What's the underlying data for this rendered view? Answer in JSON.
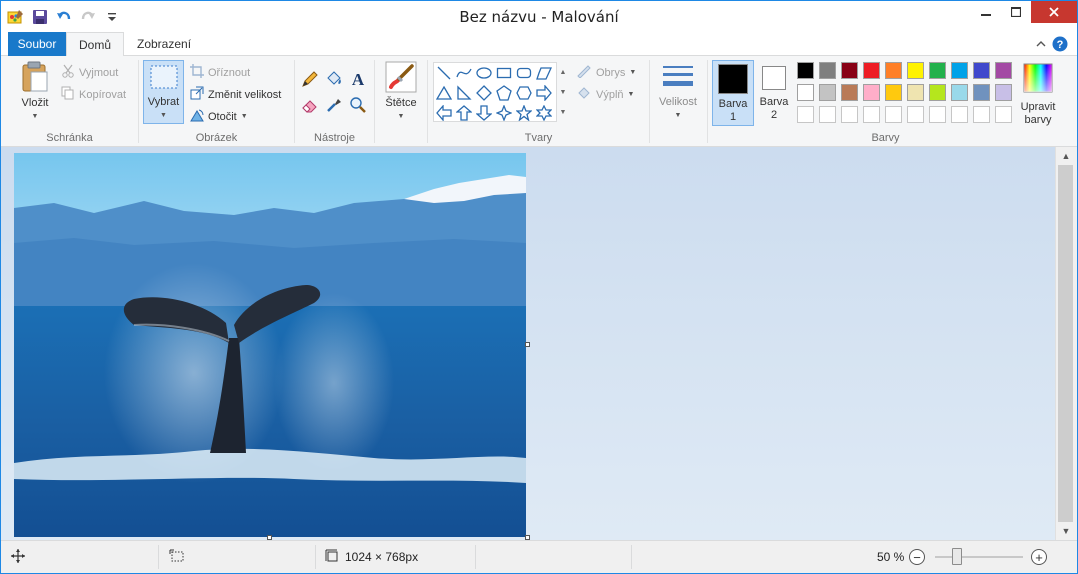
{
  "window": {
    "title": "Bez názvu - Malování",
    "controls": {
      "minimize": "—",
      "maximize": "☐",
      "close": "✕"
    }
  },
  "qat": {
    "icons": [
      "paint-app-icon",
      "save-icon",
      "undo-icon",
      "redo-icon",
      "customize-qat-icon"
    ]
  },
  "tabs": {
    "file": "Soubor",
    "home": "Domů",
    "view": "Zobrazení"
  },
  "ribbon": {
    "clipboard": {
      "label": "Schránka",
      "paste": "Vložit",
      "cut": "Vyjmout",
      "copy": "Kopírovat"
    },
    "image": {
      "label": "Obrázek",
      "select": "Vybrat",
      "crop": "Oříznout",
      "resize": "Změnit velikost",
      "rotate": "Otočit"
    },
    "tools": {
      "label": "Nástroje"
    },
    "brushes": {
      "label": "Štětce"
    },
    "shapes": {
      "label": "Tvary",
      "outline": "Obrys",
      "fill": "Výplň"
    },
    "size": {
      "label": "Velikost"
    },
    "colors": {
      "label": "Barvy",
      "color1_a": "Barva",
      "color1_b": "1",
      "color2_a": "Barva",
      "color2_b": "2",
      "edit_a": "Upravit",
      "edit_b": "barvy",
      "color1_value": "#000000",
      "color2_value": "#ffffff",
      "palette_row1": [
        "#000000",
        "#7f7f7f",
        "#880015",
        "#ed1c24",
        "#ff7f27",
        "#fff200",
        "#22b14c",
        "#00a2e8",
        "#3f48cc",
        "#a349a4"
      ],
      "palette_row2": [
        "#ffffff",
        "#c3c3c3",
        "#b97a57",
        "#ffaec9",
        "#ffc90e",
        "#efe4b0",
        "#b5e61d",
        "#99d9ea",
        "#7092be",
        "#c8bfe7"
      ]
    }
  },
  "canvas": {
    "image_description": "whale-tail-photo"
  },
  "status": {
    "dimensions": "1024 × 768px",
    "zoom": "50 %"
  }
}
